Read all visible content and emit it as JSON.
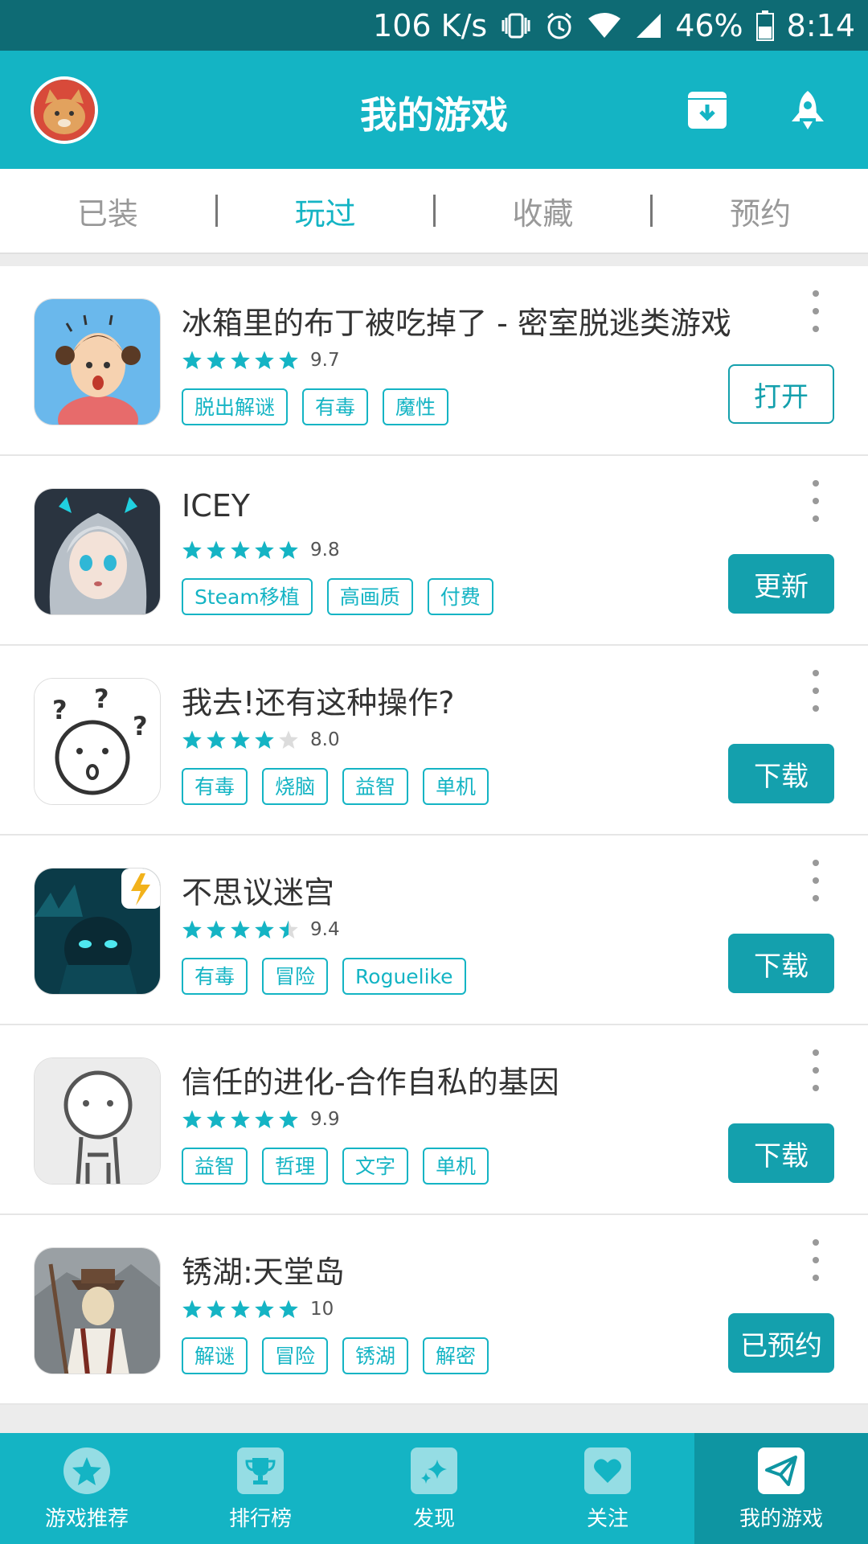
{
  "status_bar": {
    "net_speed": "106 K/s",
    "battery": "46%",
    "time": "8:14"
  },
  "app_bar": {
    "title": "我的游戏"
  },
  "tabs": [
    {
      "label": "已装"
    },
    {
      "label": "玩过",
      "active": true
    },
    {
      "label": "收藏"
    },
    {
      "label": "预约"
    }
  ],
  "games": [
    {
      "name": "冰箱里的布丁被吃掉了 - 密室脱逃类游戏",
      "rating": "9.7",
      "stars": 5,
      "tags": [
        "脱出解谜",
        "有毒",
        "魔性"
      ],
      "action": "打开",
      "action_style": "outline"
    },
    {
      "name": "ICEY",
      "rating": "9.8",
      "stars": 5,
      "tags": [
        "Steam移植",
        "高画质",
        "付费"
      ],
      "action": "更新",
      "action_style": "filled"
    },
    {
      "name": "我去!还有这种操作?",
      "rating": "8.0",
      "stars": 4,
      "tags": [
        "有毒",
        "烧脑",
        "益智",
        "单机"
      ],
      "action": "下载",
      "action_style": "filled"
    },
    {
      "name": "不思议迷宫",
      "rating": "9.4",
      "stars": 4.5,
      "tags": [
        "有毒",
        "冒险",
        "Roguelike"
      ],
      "action": "下载",
      "action_style": "filled"
    },
    {
      "name": "信任的进化-合作自私的基因",
      "rating": "9.9",
      "stars": 5,
      "tags": [
        "益智",
        "哲理",
        "文字",
        "单机"
      ],
      "action": "下载",
      "action_style": "filled"
    },
    {
      "name": "锈湖:天堂岛",
      "rating": "10",
      "stars": 5,
      "tags": [
        "解谜",
        "冒险",
        "锈湖",
        "解密"
      ],
      "action": "已预约",
      "action_style": "filled"
    }
  ],
  "bottom_nav": [
    {
      "label": "游戏推荐",
      "icon": "star-icon"
    },
    {
      "label": "排行榜",
      "icon": "trophy-icon"
    },
    {
      "label": "发现",
      "icon": "sparkle-icon"
    },
    {
      "label": "关注",
      "icon": "heart-icon"
    },
    {
      "label": "我的游戏",
      "icon": "paper-plane-icon",
      "active": true
    }
  ],
  "colors": {
    "primary": "#14b4c4",
    "status_bar": "#0e6b74",
    "button": "#14a0ad",
    "nav_active": "#0e95a2"
  }
}
